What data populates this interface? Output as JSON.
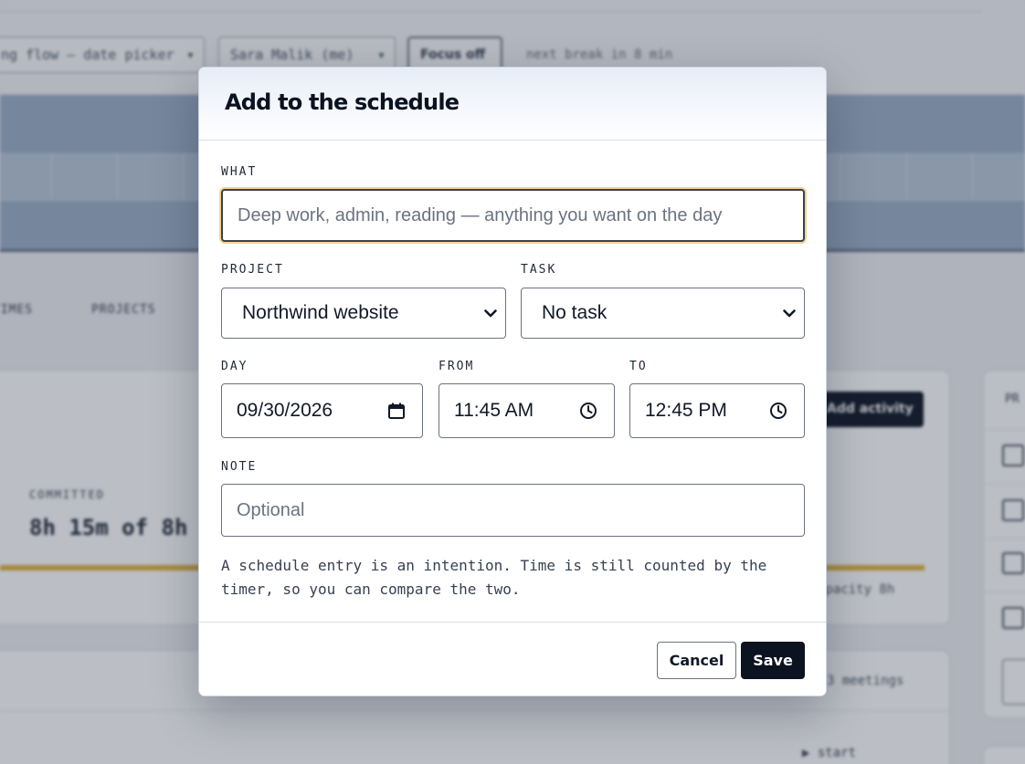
{
  "background": {
    "flow_select": "ng flow — date picker",
    "user_select": "Sara Malik (me)",
    "focus_button": "Focus off",
    "status_text": "next break in 8 min",
    "tabs": [
      "TIMES",
      "PROJECTS"
    ],
    "stat_label": "COMMITTED",
    "stat_value": "8h 15m of 8h",
    "capacity_text": "apacity 8h",
    "add_activity_label": "Add activity",
    "meetings_text": "3 meetings",
    "start_text": "▶ start",
    "panel_heading": "PR"
  },
  "modal": {
    "title": "Add to the schedule",
    "what": {
      "label": "WHAT",
      "value": "",
      "placeholder": "Deep work, admin, reading — anything you want on the day"
    },
    "project": {
      "label": "PROJECT",
      "value": "Northwind website"
    },
    "task": {
      "label": "TASK",
      "value": "No task"
    },
    "day": {
      "label": "DAY",
      "value": "09/30/2026"
    },
    "from": {
      "label": "FROM",
      "value": "11:45 AM"
    },
    "to": {
      "label": "TO",
      "value": "12:45 PM"
    },
    "note": {
      "label": "NOTE",
      "value": "",
      "placeholder": "Optional"
    },
    "help": "A schedule entry is an intention. Time is still counted by the timer, so you can compare the two.",
    "cancel_label": "Cancel",
    "save_label": "Save"
  },
  "colors": {
    "focus_ring": "#f2d58a",
    "primary_button": "#0b1220",
    "overlay": "#1e293b"
  }
}
